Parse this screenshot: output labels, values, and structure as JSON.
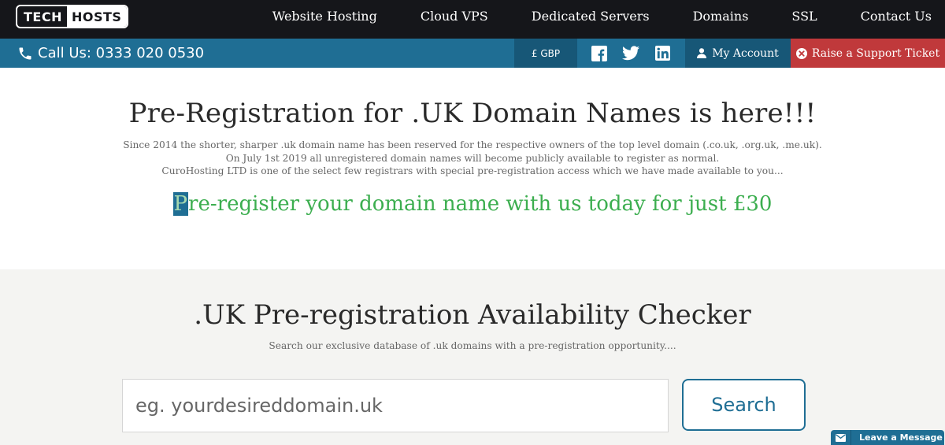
{
  "brand": {
    "part1": "TECH",
    "part2": "HOSTS"
  },
  "nav": {
    "items": [
      {
        "label": "Website Hosting"
      },
      {
        "label": "Cloud VPS"
      },
      {
        "label": "Dedicated Servers"
      },
      {
        "label": "Domains"
      },
      {
        "label": "SSL"
      },
      {
        "label": "Contact Us"
      }
    ]
  },
  "topbar": {
    "call": "Call Us: 0333 020 0530",
    "currency": "£ GBP",
    "social": [
      "facebook-icon",
      "twitter-icon",
      "linkedin-icon"
    ],
    "account": "My Account",
    "ticket": "Raise a Support Ticket"
  },
  "hero": {
    "title": "Pre-Registration for .UK Domain Names is here!!!",
    "line1": "Since 2014 the shorter, sharper .uk domain name has been reserved for the respective owners of the top level domain (.co.uk, .org.uk, .me.uk).",
    "line2": "On July 1st 2019 all unregistered domain names will become publicly available to register as normal.",
    "line3": "CuroHosting LTD is one of the select few registrars with special pre-registration access which we have made available to you...",
    "offer_first": "P",
    "offer_rest": "re-register your domain name with us today for just £30"
  },
  "checker": {
    "title": ".UK Pre-registration Availability Checker",
    "subtitle": "Search our exclusive database of .uk domains with a pre-registration opportunity....",
    "placeholder": "eg. yourdesireddomain.uk",
    "value": "",
    "button": "Search"
  },
  "chat": {
    "label": "Leave a Message"
  },
  "colors": {
    "nav_bg": "#15161a",
    "bar_blue": "#1f6e94",
    "bar_dark": "#175777",
    "ticket_red": "#c0393b",
    "offer_green": "#3cae4f",
    "checker_bg": "#f4f4f2"
  }
}
